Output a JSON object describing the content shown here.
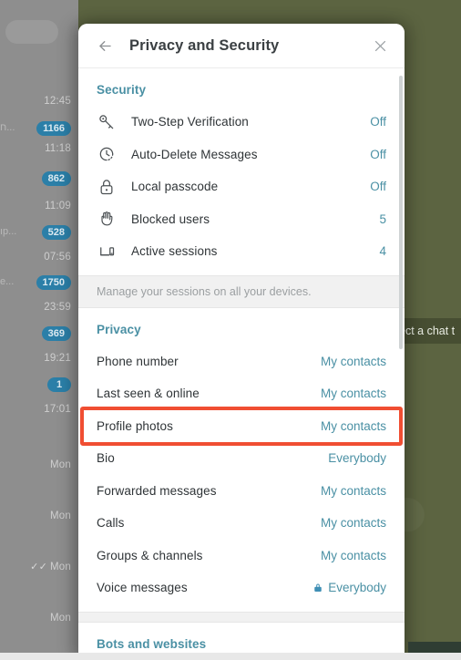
{
  "app": {
    "background_color": "#5c6441",
    "sidebar_color": "#8e8e8e",
    "accent_teal": "#4a90a4",
    "badge_blue": "#2b7fa8",
    "highlight_red": "#f04e32",
    "select_chat_text": "ect a chat t"
  },
  "chat_list": {
    "search_placeholder": "",
    "rows": [
      {
        "time": "12:45",
        "badge": "1166",
        "snippet": "ח...",
        "tick": ""
      },
      {
        "time": "11:18",
        "badge": "862",
        "snippet": "",
        "tick": ""
      },
      {
        "time": "11:09",
        "badge": "528",
        "snippet": "ıp...",
        "tick": ""
      },
      {
        "time": "07:56",
        "badge": "1750",
        "snippet": "e...",
        "tick": ""
      },
      {
        "time": "23:59",
        "badge": "369",
        "snippet": "",
        "tick": ""
      },
      {
        "time": "19:21",
        "badge": "1",
        "snippet": "",
        "tick": ""
      },
      {
        "time": "17:01",
        "badge": "",
        "snippet": "",
        "tick": ""
      },
      {
        "time": "Mon",
        "badge": "",
        "snippet": "",
        "tick": ""
      },
      {
        "time": "Mon",
        "badge": "",
        "snippet": "",
        "tick": ""
      },
      {
        "time": "Mon",
        "badge": "",
        "snippet": "",
        "tick": "✓✓"
      },
      {
        "time": "Mon",
        "badge": "",
        "snippet": "",
        "tick": ""
      }
    ]
  },
  "panel": {
    "title": "Privacy and Security",
    "back_icon": "back-arrow-icon",
    "close_icon": "close-icon",
    "security": {
      "heading": "Security",
      "items": [
        {
          "icon": "key-icon",
          "label": "Two-Step Verification",
          "value": "Off"
        },
        {
          "icon": "auto-delete-timer-icon",
          "label": "Auto-Delete Messages",
          "value": "Off"
        },
        {
          "icon": "lock-icon",
          "label": "Local passcode",
          "value": "Off"
        },
        {
          "icon": "hand-stop-icon",
          "label": "Blocked users",
          "value": "5"
        },
        {
          "icon": "devices-icon",
          "label": "Active sessions",
          "value": "4"
        }
      ],
      "sessions_note": "Manage your sessions on all your devices."
    },
    "privacy": {
      "heading": "Privacy",
      "items": [
        {
          "label": "Phone number",
          "value": "My contacts",
          "locked": false,
          "highlighted": false
        },
        {
          "label": "Last seen & online",
          "value": "My contacts",
          "locked": false,
          "highlighted": false
        },
        {
          "label": "Profile photos",
          "value": "My contacts",
          "locked": false,
          "highlighted": true
        },
        {
          "label": "Bio",
          "value": "Everybody",
          "locked": false,
          "highlighted": false
        },
        {
          "label": "Forwarded messages",
          "value": "My contacts",
          "locked": false,
          "highlighted": false
        },
        {
          "label": "Calls",
          "value": "My contacts",
          "locked": false,
          "highlighted": false
        },
        {
          "label": "Groups & channels",
          "value": "My contacts",
          "locked": false,
          "highlighted": false
        },
        {
          "label": "Voice messages",
          "value": "Everybody",
          "locked": true,
          "highlighted": false
        }
      ]
    },
    "bots": {
      "heading": "Bots and websites"
    }
  }
}
